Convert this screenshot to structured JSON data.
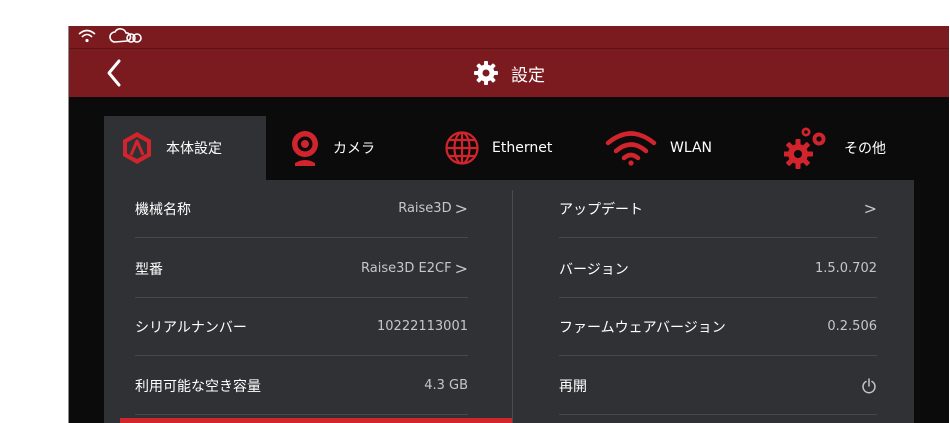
{
  "header": {
    "title": "設定"
  },
  "status_icons": [
    "wifi-icon",
    "cloud-link-icon"
  ],
  "tabs": [
    {
      "label": "本体設定",
      "icon": "raise3d-logo-icon",
      "active": true
    },
    {
      "label": "カメラ",
      "icon": "camera-icon",
      "active": false
    },
    {
      "label": "Ethernet",
      "icon": "globe-icon",
      "active": false
    },
    {
      "label": "WLAN",
      "icon": "wifi-icon",
      "active": false
    },
    {
      "label": "その他",
      "icon": "gears-icon",
      "active": false
    }
  ],
  "left_rows": [
    {
      "label": "機械名称",
      "value": "Raise3D",
      "chevron": ">"
    },
    {
      "label": "型番",
      "value": "Raise3D E2CF",
      "chevron": ">"
    },
    {
      "label": "シリアルナンバー",
      "value": "10222113001"
    },
    {
      "label": "利用可能な空き容量",
      "value": "4.3 GB"
    }
  ],
  "right_rows": [
    {
      "label": "アップデート",
      "value": "",
      "chevron": ">"
    },
    {
      "label": "バージョン",
      "value": "1.5.0.702"
    },
    {
      "label": "ファームウェアバージョン",
      "value": "0.2.506"
    },
    {
      "label": "再開",
      "icon": "power-icon"
    }
  ],
  "colors": {
    "accent": "#d1242c",
    "header_bg": "#7b1a1f",
    "panel_bg": "#2f3134",
    "screen_bg": "#0b0b0b"
  }
}
